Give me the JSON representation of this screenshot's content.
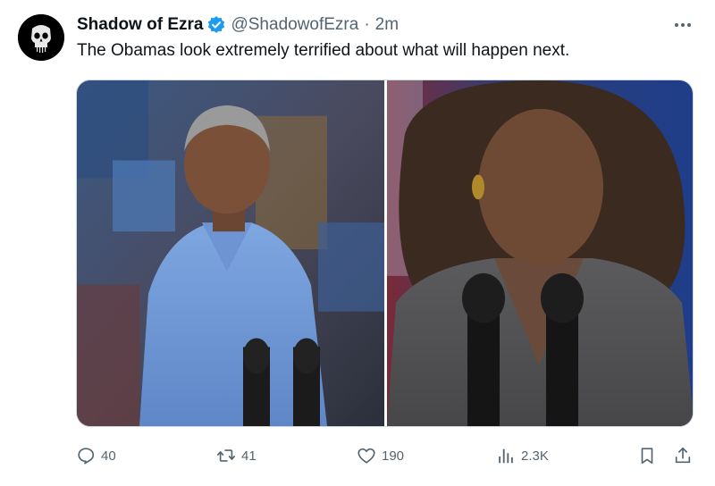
{
  "author": {
    "display_name": "Shadow of Ezra",
    "handle": "@ShadowofEzra",
    "separator": "·",
    "time": "2m",
    "verified": true,
    "avatar_icon": "punisher-skull-icon"
  },
  "tweet": {
    "text": "The Obamas look extremely terrified about what will happen next."
  },
  "media": {
    "photos": [
      {
        "name": "photo-left",
        "icon": "photo-man-blue-shirt"
      },
      {
        "name": "photo-right",
        "icon": "photo-woman-gray-suit"
      }
    ]
  },
  "actions": {
    "reply_count": "40",
    "retweet_count": "41",
    "like_count": "190",
    "views_count": "2.3K"
  },
  "colors": {
    "text": "#0f1419",
    "muted": "#536471",
    "verified_blue": "#1d9bf0",
    "border": "#cfd9de"
  }
}
